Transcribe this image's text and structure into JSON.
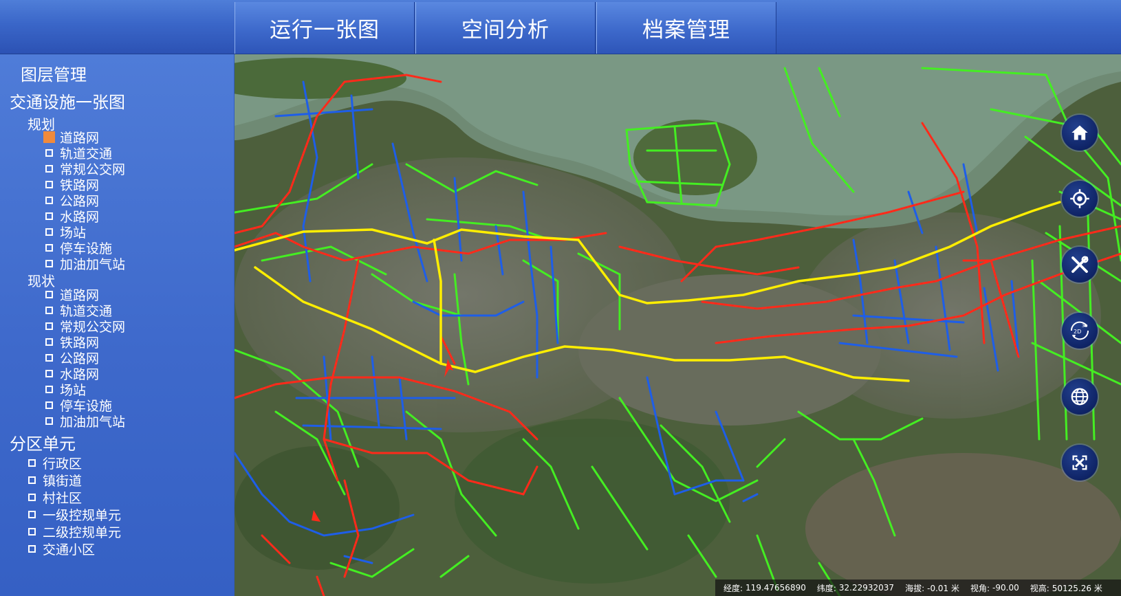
{
  "tabs": [
    "运行一张图",
    "空间分析",
    "档案管理"
  ],
  "sidebar": {
    "title": "图层管理",
    "group1": {
      "label": "交通设施一张图",
      "planned": {
        "label": "规划",
        "items": [
          "道路网",
          "轨道交通",
          "常规公交网",
          "铁路网",
          "公路网",
          "水路网",
          "场站",
          "停车设施",
          "加油加气站"
        ]
      },
      "current": {
        "label": "现状",
        "items": [
          "道路网",
          "轨道交通",
          "常规公交网",
          "铁路网",
          "公路网",
          "水路网",
          "场站",
          "停车设施",
          "加油加气站"
        ]
      }
    },
    "group2": {
      "label": "分区单元",
      "items": [
        "行政区",
        "镇街道",
        "村社区",
        "一级控规单元",
        "二级控规单元",
        "交通小区"
      ]
    },
    "checked_color": "#f08a3c"
  },
  "map": {
    "road_colors": {
      "red": "#ff2a1a",
      "blue": "#1e5ee8",
      "green": "#44ee22",
      "yellow": "#ffee00"
    },
    "tools": [
      "home-icon",
      "locate-icon",
      "tools-icon",
      "2d-3d-switch-icon",
      "globe-icon",
      "fullscreen-icon"
    ]
  },
  "status": {
    "lon_label": "经度:",
    "lon": "119.47656890",
    "lat_label": "纬度:",
    "lat": "32.22932037",
    "alt_label": "海拔:",
    "alt": "-0.01 米",
    "view_label": "视角:",
    "view": "-90.00",
    "height_label": "视高:",
    "height": "50125.26 米"
  }
}
